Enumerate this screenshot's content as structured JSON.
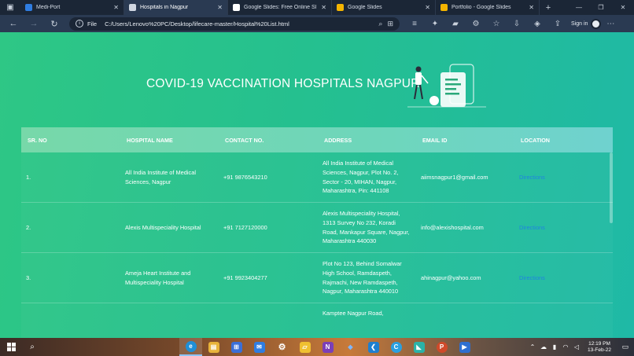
{
  "browser": {
    "tabs": [
      {
        "label": "Medi-Port",
        "color": "#2f7de1",
        "active": false
      },
      {
        "label": "Hospitals in Nagpur",
        "color": "#d0d7e2",
        "active": true
      },
      {
        "label": "Google Slides: Free Online Sl",
        "color": "#ffffff",
        "active": false
      },
      {
        "label": "Google Slides",
        "color": "#f4b400",
        "active": false
      },
      {
        "label": "Portfolio - Google Slides",
        "color": "#f4b400",
        "active": false
      }
    ],
    "new_tab": "+",
    "address": {
      "scheme": "File",
      "url": "C:/Users/Lenovo%20PC/Desktop/lifecare-master/Hospital%20List.html"
    },
    "sign_in": "Sign in"
  },
  "page": {
    "title": "COVID-19 VACCINATION HOSPITALS NAGPUR",
    "table": {
      "headers": [
        "SR. NO",
        "HOSPITAL NAME",
        "CONTACT NO.",
        "ADDRESS",
        "EMAIL ID",
        "LOCATION"
      ],
      "rows": [
        {
          "sr": "1.",
          "name": "All India Institute of Medical Sciences, Nagpur",
          "contact": "+91 9876543210",
          "address": "All India Institute of Medical Sciences, Nagpur, Plot No. 2, Sector - 20, MIHAN, Nagpur, Maharashtra, Pin: 441108",
          "email": "aiimsnagpur1@gmail.com",
          "location": "Directions"
        },
        {
          "sr": "2.",
          "name": "Alexis Multispeciality Hospital",
          "contact": "+91 7127120000",
          "address": "Alexis Multispeciality Hospital, 1313 Survey No 232, Koradi Road, Mankapur Square, Nagpur, Maharashtra 440030",
          "email": "info@alexishospital.com",
          "location": "Directions"
        },
        {
          "sr": "3.",
          "name": "Ameja Heart Institute and Multispeciality Hospital",
          "contact": "+91 9923404277",
          "address": "Plot No 123, Behind Somalwar High School, Ramdaspeth, Rajmachi, New Ramdaspeth, Nagpur, Maharashtra 440010",
          "email": "ahinagpur@yahoo.com",
          "location": "Directions"
        },
        {
          "sr": "",
          "name": "",
          "contact": "",
          "address": "Kamptee Nagpur Road,",
          "email": "",
          "location": ""
        }
      ]
    }
  },
  "taskbar": {
    "clock_time": "12:19 PM",
    "clock_date": "13-Feb-22"
  },
  "colors": {
    "link": "#1f84e0",
    "page_gradient_start": "#2ec785",
    "page_gradient_end": "#1fb9a6"
  }
}
